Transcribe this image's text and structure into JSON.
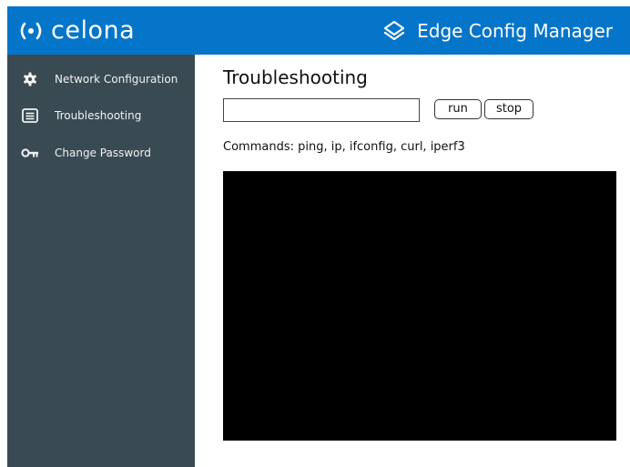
{
  "header": {
    "brand": "celona",
    "app_title": "Edge Config Manager"
  },
  "sidebar": {
    "items": [
      {
        "label": "Network Configuration",
        "icon": "gear-icon"
      },
      {
        "label": "Troubleshooting",
        "icon": "terminal-list-icon"
      },
      {
        "label": "Change Password",
        "icon": "key-icon"
      }
    ]
  },
  "main": {
    "title": "Troubleshooting",
    "command_input": {
      "value": "",
      "placeholder": ""
    },
    "run_label": "run",
    "stop_label": "stop",
    "commands_text": "Commands: ping, ip, ifconfig, curl, iperf3"
  },
  "colors": {
    "header_bg": "#0575c9",
    "sidebar_bg": "#3a4a52",
    "terminal_bg": "#000000"
  }
}
